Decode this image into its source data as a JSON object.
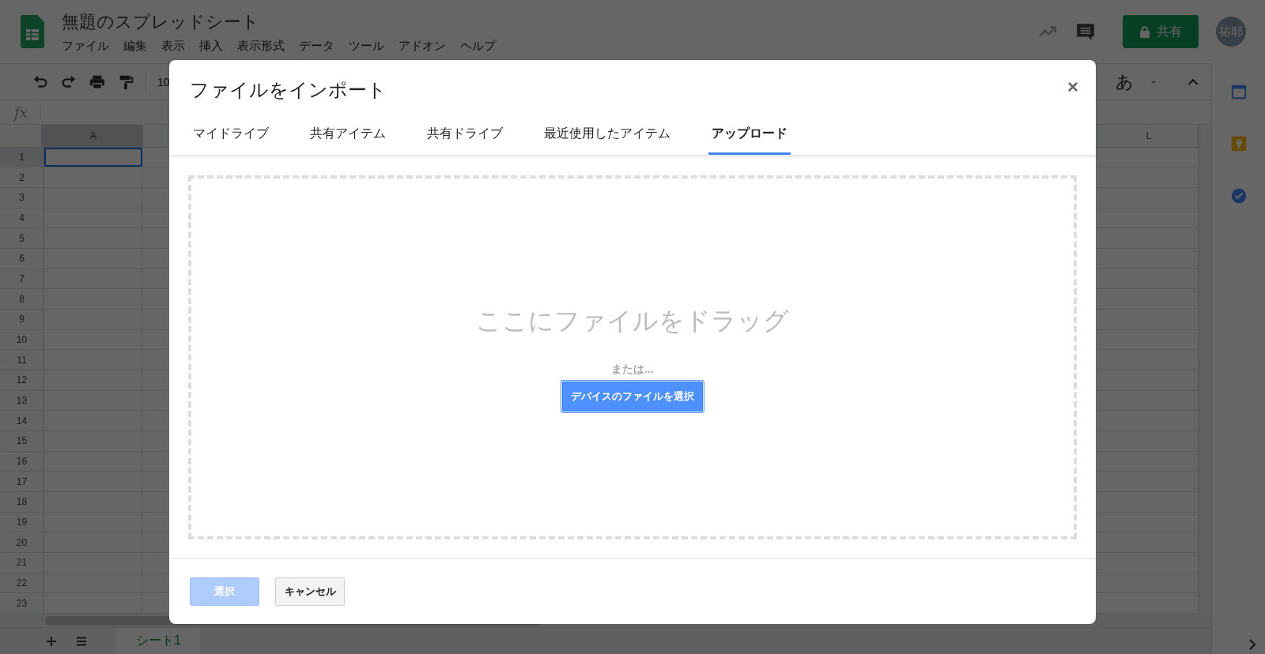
{
  "app": {
    "title": "無題のスプレッドシート",
    "menu": [
      "ファイル",
      "編集",
      "表示",
      "挿入",
      "表示形式",
      "データ",
      "ツール",
      "アドオン",
      "ヘルプ"
    ],
    "share_button": "共有",
    "avatar": "祐耶"
  },
  "toolbar": {
    "zoom": "10",
    "input_tool": "あ"
  },
  "formula_bar": {
    "label": "fx"
  },
  "grid": {
    "columns": [
      {
        "label": "A",
        "selected": true
      },
      {
        "label": "L",
        "selected": false
      }
    ],
    "rows": [
      {
        "label": "1",
        "selected": true
      },
      {
        "label": "2",
        "selected": false
      },
      {
        "label": "3",
        "selected": false
      },
      {
        "label": "4",
        "selected": false
      },
      {
        "label": "5",
        "selected": false
      },
      {
        "label": "6",
        "selected": false
      },
      {
        "label": "7",
        "selected": false
      },
      {
        "label": "8",
        "selected": false
      },
      {
        "label": "9",
        "selected": false
      },
      {
        "label": "10",
        "selected": false
      },
      {
        "label": "11",
        "selected": false
      },
      {
        "label": "12",
        "selected": false
      },
      {
        "label": "13",
        "selected": false
      },
      {
        "label": "14",
        "selected": false
      },
      {
        "label": "15",
        "selected": false
      },
      {
        "label": "16",
        "selected": false
      },
      {
        "label": "17",
        "selected": false
      },
      {
        "label": "18",
        "selected": false
      },
      {
        "label": "19",
        "selected": false
      },
      {
        "label": "20",
        "selected": false
      },
      {
        "label": "21",
        "selected": false
      },
      {
        "label": "22",
        "selected": false
      },
      {
        "label": "23",
        "selected": false
      }
    ]
  },
  "sheet_tabs": [
    {
      "label": "シート1",
      "selected": true
    }
  ],
  "dialog": {
    "title": "ファイルをインポート",
    "close": "×",
    "tabs": [
      {
        "label": "マイドライブ",
        "selected": false
      },
      {
        "label": "共有アイテム",
        "selected": false
      },
      {
        "label": "共有ドライブ",
        "selected": false
      },
      {
        "label": "最近使用したアイテム",
        "selected": false
      },
      {
        "label": "アップロード",
        "selected": true
      }
    ],
    "drop_zone": {
      "heading": "ここにファイルをドラッグ",
      "or": "または...",
      "button": "デバイスのファイルを選択"
    },
    "buttons": [
      {
        "label": "選択",
        "kind": "primary",
        "disabled": true
      },
      {
        "label": "キャンセル",
        "kind": "secondary",
        "disabled": false
      }
    ]
  }
}
